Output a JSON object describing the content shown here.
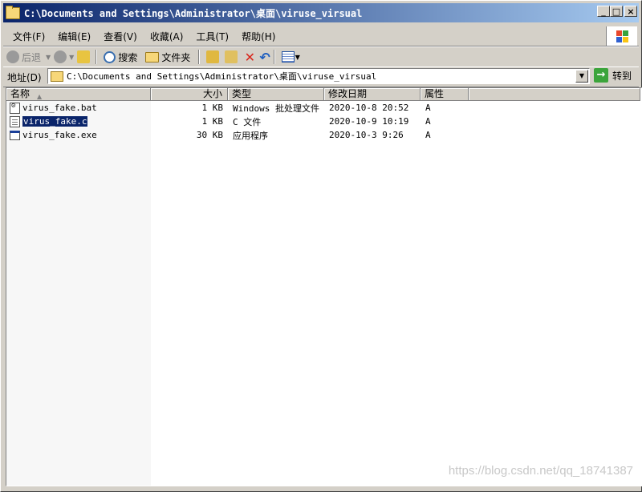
{
  "window": {
    "title": "C:\\Documents and Settings\\Administrator\\桌面\\viruse_virsual",
    "minimize": "_",
    "maximize": "□",
    "close": "×"
  },
  "menu": [
    "文件(F)",
    "编辑(E)",
    "查看(V)",
    "收藏(A)",
    "工具(T)",
    "帮助(H)"
  ],
  "toolbar": {
    "back": "后退",
    "search": "搜索",
    "folders": "文件夹"
  },
  "address": {
    "label": "地址(D)",
    "path": "C:\\Documents and Settings\\Administrator\\桌面\\viruse_virsual",
    "go": "转到"
  },
  "columns": {
    "name": "名称",
    "size": "大小",
    "type": "类型",
    "modified": "修改日期",
    "attributes": "属性"
  },
  "files": [
    {
      "name": "virus_fake.bat",
      "size": "1 KB",
      "type": "Windows 批处理文件",
      "modified": "2020-10-8 20:52",
      "attr": "A",
      "icon": "batch-file-icon"
    },
    {
      "name": "virus_fake.c",
      "size": "1 KB",
      "type": "C 文件",
      "modified": "2020-10-9 10:19",
      "attr": "A",
      "icon": "c-file-icon",
      "selected": true
    },
    {
      "name": "virus_fake.exe",
      "size": "30 KB",
      "type": "应用程序",
      "modified": "2020-10-3 9:26",
      "attr": "A",
      "icon": "exe-file-icon"
    }
  ],
  "watermark": "https://blog.csdn.net/qq_18741387",
  "colors": {
    "title_start": "#0a246a",
    "title_end": "#a6caf0",
    "selection": "#0a246a",
    "face": "#d4d0c8"
  }
}
